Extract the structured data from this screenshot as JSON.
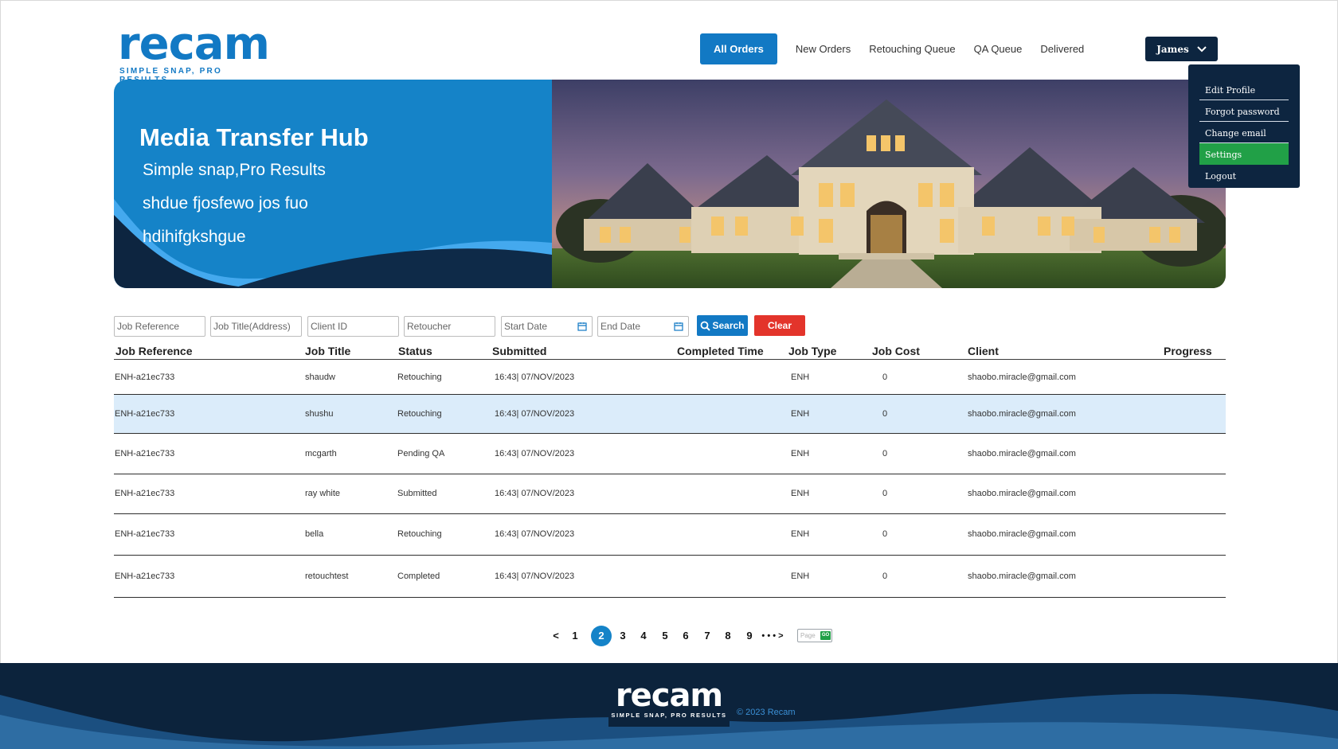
{
  "brand": {
    "name": "recam",
    "tagline": "SIMPLE SNAP, PRO RESULTS"
  },
  "nav": {
    "items": [
      "All Orders",
      "New Orders",
      "Retouching Queue",
      "QA Queue",
      "Delivered"
    ],
    "active": "All Orders"
  },
  "user": {
    "name": "James",
    "menu": [
      "Edit Profile",
      "Forgot password",
      "Change email",
      "Settings",
      "Logout"
    ],
    "menu_active": "Settings"
  },
  "hero": {
    "title": "Media Transfer Hub",
    "lines": [
      "Simple snap,Pro Results",
      "shdue fjosfewo jos fuo",
      "hdihifgkshgue"
    ]
  },
  "filters": {
    "placeholders": [
      "Job Reference",
      "Job Title(Address)",
      "Client ID",
      "Retoucher",
      "Start Date",
      "End Date"
    ],
    "search_label": "Search",
    "clear_label": "Clear"
  },
  "table": {
    "columns": [
      "Job Reference",
      "Job Title",
      "Status",
      "Submitted",
      "Completed Time",
      "Job Type",
      "Job Cost",
      "Client",
      "Progress"
    ],
    "rows": [
      {
        "ref": "ENH-a21ec733",
        "title": "shaudw",
        "status": "Retouching",
        "submitted": "16:43| 07/NOV/2023",
        "completed": "",
        "type": "ENH",
        "cost": "0",
        "client": "shaobo.miracle@gmail.com",
        "progress": ""
      },
      {
        "ref": "ENH-a21ec733",
        "title": "shushu",
        "status": "Retouching",
        "submitted": "16:43| 07/NOV/2023",
        "completed": "",
        "type": "ENH",
        "cost": "0",
        "client": "shaobo.miracle@gmail.com",
        "progress": ""
      },
      {
        "ref": "ENH-a21ec733",
        "title": "mcgarth",
        "status": "Pending QA",
        "submitted": "16:43| 07/NOV/2023",
        "completed": "",
        "type": "ENH",
        "cost": "0",
        "client": "shaobo.miracle@gmail.com",
        "progress": ""
      },
      {
        "ref": "ENH-a21ec733",
        "title": "ray white",
        "status": "Submitted",
        "submitted": "16:43| 07/NOV/2023",
        "completed": "",
        "type": "ENH",
        "cost": "0",
        "client": "shaobo.miracle@gmail.com",
        "progress": ""
      },
      {
        "ref": "ENH-a21ec733",
        "title": "bella",
        "status": "Retouching",
        "submitted": "16:43| 07/NOV/2023",
        "completed": "",
        "type": "ENH",
        "cost": "0",
        "client": "shaobo.miracle@gmail.com",
        "progress": ""
      },
      {
        "ref": "ENH-a21ec733",
        "title": "retouchtest",
        "status": "Completed",
        "submitted": "16:43| 07/NOV/2023",
        "completed": "",
        "type": "ENH",
        "cost": "0",
        "client": "shaobo.miracle@gmail.com",
        "progress": ""
      }
    ],
    "selected_row": 2
  },
  "pagination": {
    "prev": "<",
    "pages": [
      "1",
      "2",
      "3",
      "4",
      "5",
      "6",
      "7",
      "8",
      "9"
    ],
    "current": "2",
    "more": "• • • >",
    "page_placeholder": "Page",
    "go_label": "GO"
  },
  "footer": {
    "copyright": "2023 Recam",
    "copyright_symbol": "©"
  },
  "colors": {
    "primary": "#1279c4",
    "navy": "#0d2540",
    "green": "#21a047",
    "red": "#e3342b",
    "selected_row": "#dbecfa"
  },
  "icons": [
    "chevron-down-icon",
    "search-icon",
    "calendar-icon",
    "copyright-icon"
  ]
}
